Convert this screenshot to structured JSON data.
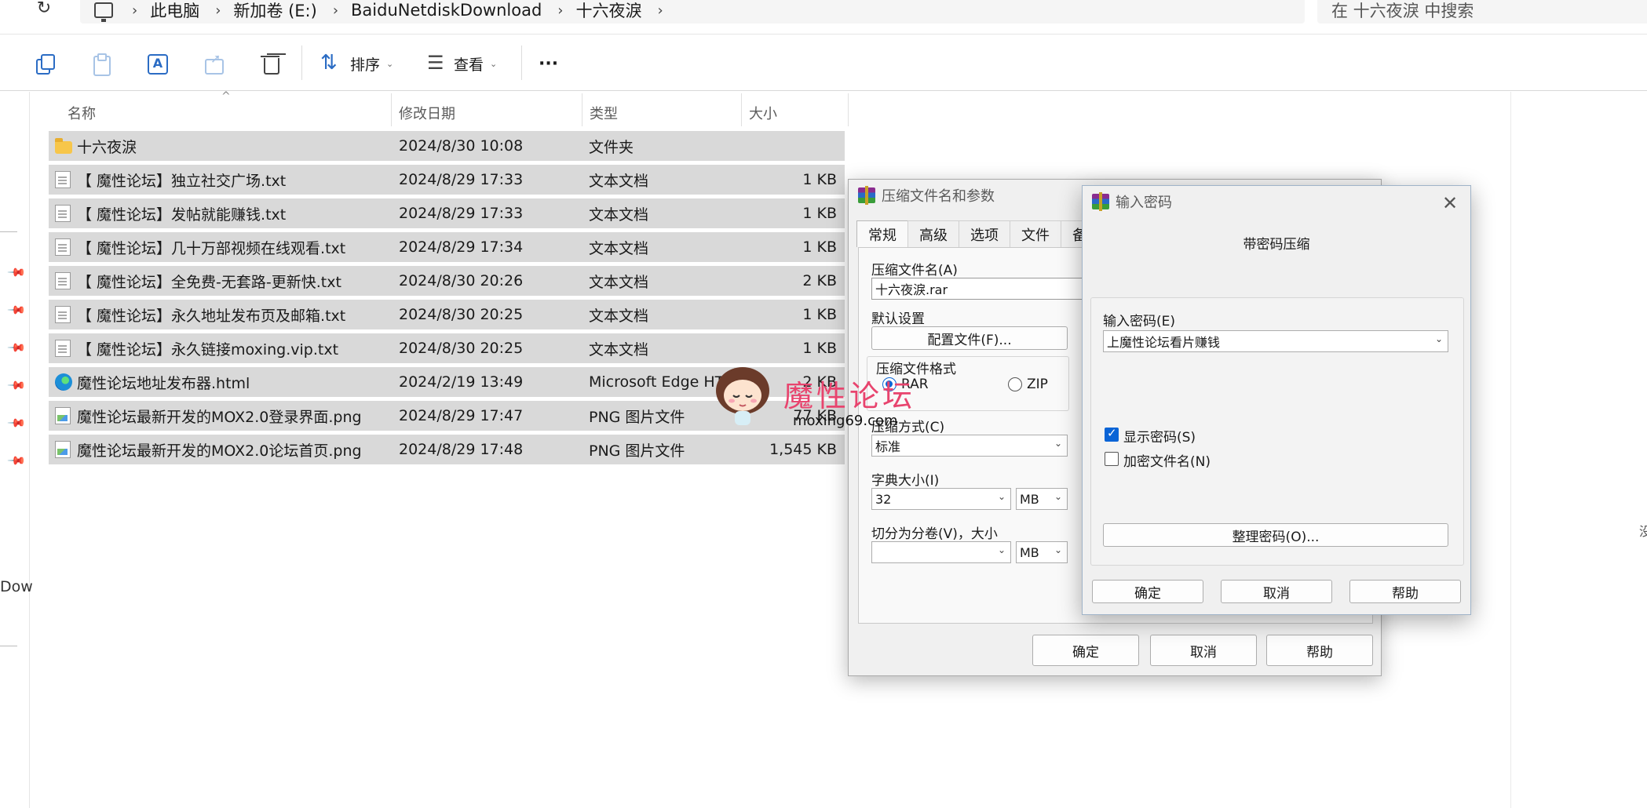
{
  "address": {
    "crumbs": [
      "此电脑",
      "新加卷 (E:)",
      "BaiduNetdiskDownload",
      "十六夜淚"
    ],
    "search_placeholder": "在 十六夜淚 中搜索"
  },
  "toolbar": {
    "sort_label": "排序",
    "view_label": "查看",
    "more_label": "···"
  },
  "leftnav": {
    "truncated_label": "Dow"
  },
  "columns": {
    "name": "名称",
    "date": "修改日期",
    "type": "类型",
    "size": "大小"
  },
  "files": [
    {
      "name": "十六夜淚",
      "date": "2024/8/30 10:08",
      "type": "文件夹",
      "size": "",
      "icon": "folder"
    },
    {
      "name": "【 魔性论坛】独立社交广场.txt",
      "date": "2024/8/29 17:33",
      "type": "文本文档",
      "size": "1 KB",
      "icon": "txt"
    },
    {
      "name": "【 魔性论坛】发帖就能赚钱.txt",
      "date": "2024/8/29 17:33",
      "type": "文本文档",
      "size": "1 KB",
      "icon": "txt"
    },
    {
      "name": "【 魔性论坛】几十万部视频在线观看.txt",
      "date": "2024/8/29 17:34",
      "type": "文本文档",
      "size": "1 KB",
      "icon": "txt"
    },
    {
      "name": "【 魔性论坛】全免费-无套路-更新快.txt",
      "date": "2024/8/30 20:26",
      "type": "文本文档",
      "size": "2 KB",
      "icon": "txt"
    },
    {
      "name": "【 魔性论坛】永久地址发布页及邮箱.txt",
      "date": "2024/8/30 20:25",
      "type": "文本文档",
      "size": "1 KB",
      "icon": "txt"
    },
    {
      "name": "【 魔性论坛】永久链接moxing.vip.txt",
      "date": "2024/8/30 20:25",
      "type": "文本文档",
      "size": "1 KB",
      "icon": "txt"
    },
    {
      "name": "魔性论坛地址发布器.html",
      "date": "2024/2/19 13:49",
      "type": "Microsoft Edge HT",
      "size": "2 KB",
      "icon": "edge"
    },
    {
      "name": "魔性论坛最新开发的MOX2.0登录界面.png",
      "date": "2024/8/29 17:47",
      "type": "PNG 图片文件",
      "size": "77 KB",
      "icon": "png"
    },
    {
      "name": "魔性论坛最新开发的MOX2.0论坛首页.png",
      "date": "2024/8/29 17:48",
      "type": "PNG 图片文件",
      "size": "1,545 KB",
      "icon": "png"
    }
  ],
  "rar_dialog": {
    "title": "压缩文件名和参数",
    "tabs": [
      "常规",
      "高级",
      "选项",
      "文件",
      "备"
    ],
    "archive_name_label": "压缩文件名(A)",
    "archive_name_value": "十六夜淚.rar",
    "default_settings_label": "默认设置",
    "profiles_button": "配置文件(F)...",
    "format_label": "压缩文件格式",
    "format_rar": "RAR",
    "format_zip": "ZIP",
    "method_label": "压缩方式(C)",
    "method_value": "标准",
    "dict_label": "字典大小(I)",
    "dict_value": "32",
    "dict_unit": "MB",
    "split_label": "切分为分卷(V)，大小",
    "split_value": "",
    "split_unit": "MB",
    "ok": "确定",
    "cancel": "取消",
    "help": "帮助"
  },
  "pw_dialog": {
    "title": "输入密码",
    "heading": "带密码压缩",
    "enter_label": "输入密码(E)",
    "password_value": "上魔性论坛看片赚钱",
    "show_password": "显示密码(S)",
    "show_password_checked": true,
    "encrypt_names": "加密文件名(N)",
    "encrypt_names_checked": false,
    "organize_button": "整理密码(O)...",
    "ok": "确定",
    "cancel": "取消",
    "help": "帮助"
  },
  "watermark": {
    "text": "魔性论坛",
    "url": "moxing69.com"
  },
  "edge_text": "没"
}
